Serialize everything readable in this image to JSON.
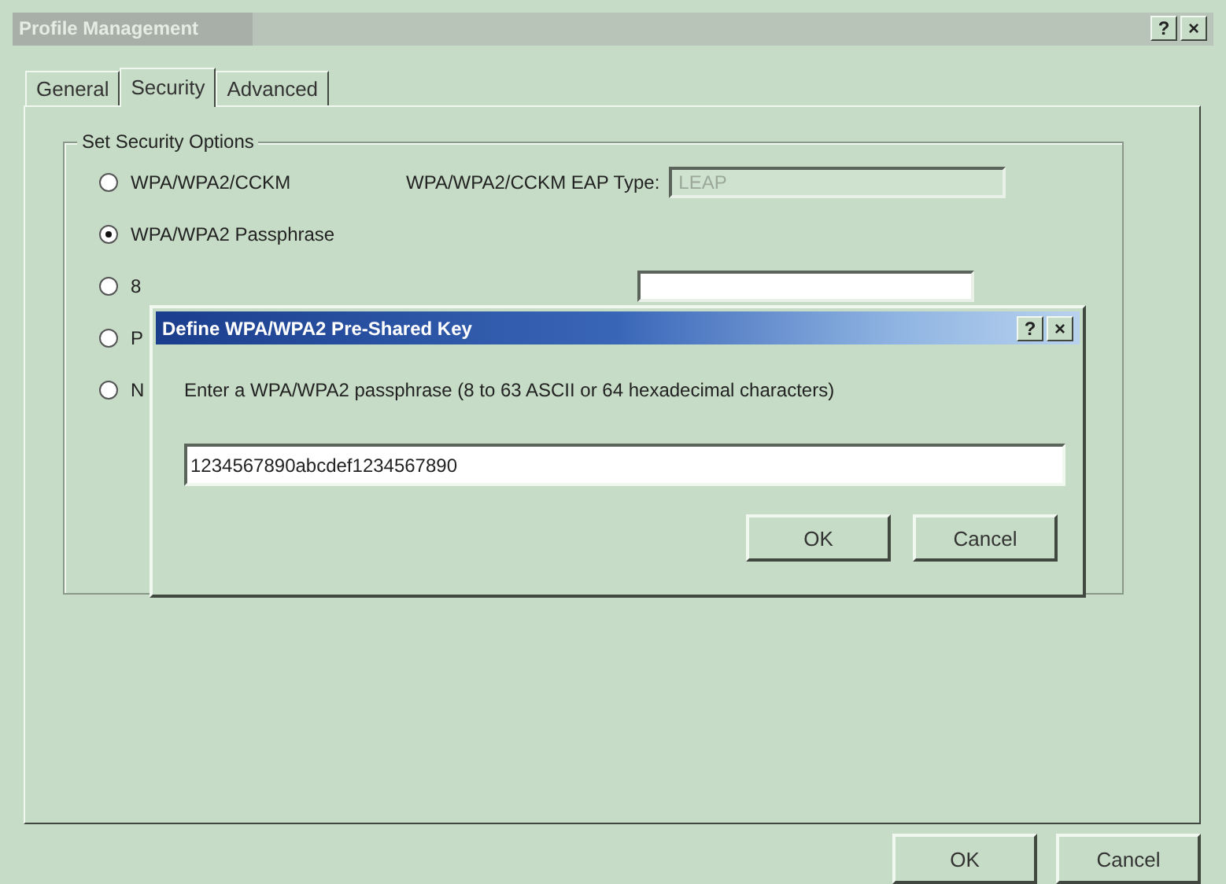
{
  "window": {
    "title": "Profile Management",
    "help": "?",
    "close": "×"
  },
  "tabs": [
    {
      "label": "General",
      "selected": false
    },
    {
      "label": "Security",
      "selected": true
    },
    {
      "label": "Advanced",
      "selected": false
    }
  ],
  "security_options": {
    "title": "Set Security Options",
    "options": [
      {
        "label": "WPA/WPA2/CCKM",
        "selected": false
      },
      {
        "label": "WPA/WPA2 Passphrase",
        "selected": true
      },
      {
        "label": "8",
        "selected": false
      },
      {
        "label": "P",
        "selected": false
      },
      {
        "label": "N",
        "selected": false
      }
    ],
    "eap_type": {
      "label": "WPA/WPA2/CCKM EAP Type:",
      "value": "LEAP",
      "disabled": true
    }
  },
  "dialog": {
    "title": "Define WPA/WPA2 Pre-Shared Key",
    "help": "?",
    "close": "×",
    "prompt": "Enter a WPA/WPA2 passphrase (8 to 63 ASCII or 64 hexadecimal characters)",
    "value": "1234567890abcdef1234567890",
    "buttons": [
      "OK",
      "Cancel"
    ]
  },
  "buttons": [
    "OK",
    "Cancel"
  ]
}
